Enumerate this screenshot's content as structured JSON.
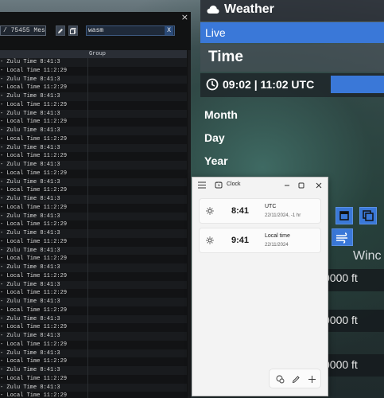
{
  "log_panel": {
    "close_glyph": "×",
    "message_count": "/ 75455 Messages",
    "filter": {
      "value": "wasm",
      "clear_label": "X"
    },
    "columns": {
      "message": "",
      "group": "Group"
    },
    "rows": [
      "- Zulu Time 8:41:3",
      "- Local Time 11:2:29",
      "- Zulu Time 8:41:3",
      "- Local Time 11:2:29",
      "- Zulu Time 8:41:3",
      "- Local Time 11:2:29",
      "- Zulu Time 8:41:3",
      "- Local Time 11:2:29",
      "- Zulu Time 8:41:3",
      "- Local Time 11:2:29",
      "- Zulu Time 8:41:3",
      "- Local Time 11:2:29",
      "- Zulu Time 8:41:3",
      "- Local Time 11:2:29",
      "- Zulu Time 8:41:3",
      "- Local Time 11:2:29",
      "- Zulu Time 8:41:3",
      "- Local Time 11:2:29",
      "- Zulu Time 8:41:3",
      "- Local Time 11:2:29",
      "- Zulu Time 8:41:3",
      "- Local Time 11:2:29",
      "- Zulu Time 8:41:3",
      "- Local Time 11:2:29",
      "- Zulu Time 8:41:3",
      "- Local Time 11:2:29",
      "- Zulu Time 8:41:3",
      "- Local Time 11:2:29",
      "- Zulu Time 8:41:3",
      "- Local Time 11:2:29",
      "- Zulu Time 8:41:3",
      "- Local Time 11:2:29",
      "- Zulu Time 8:41:3",
      "- Local Time 11:2:29",
      "- Zulu Time 8:41:3",
      "- Local Time 11:2:29",
      "- Zulu Time 8:41:3",
      "- Local Time 11:2:29",
      "- Zulu Time 8:41:3",
      "- Local Time 11:2:29",
      "- Zulu Time 8:41:3",
      "- Local Time 11:2:29"
    ]
  },
  "weather_panel": {
    "title": "Weather",
    "tab_live": "Live",
    "time_heading": "Time",
    "clock_text": "09:02 | 11:02 UTC",
    "fields": {
      "month": "Month",
      "day": "Day",
      "year": "Year"
    },
    "wind_heading": "Winc",
    "altitudes": [
      "0000 ft",
      "0000 ft",
      "0000 ft"
    ],
    "accent_color": "#3a78d8"
  },
  "clock_app": {
    "title": "Clock",
    "cards": [
      {
        "time": "8:41",
        "name": "UTC",
        "subtitle": "22/11/2024, -1 hr"
      },
      {
        "time": "9:41",
        "name": "Local time",
        "subtitle": "22/11/2024"
      }
    ]
  }
}
